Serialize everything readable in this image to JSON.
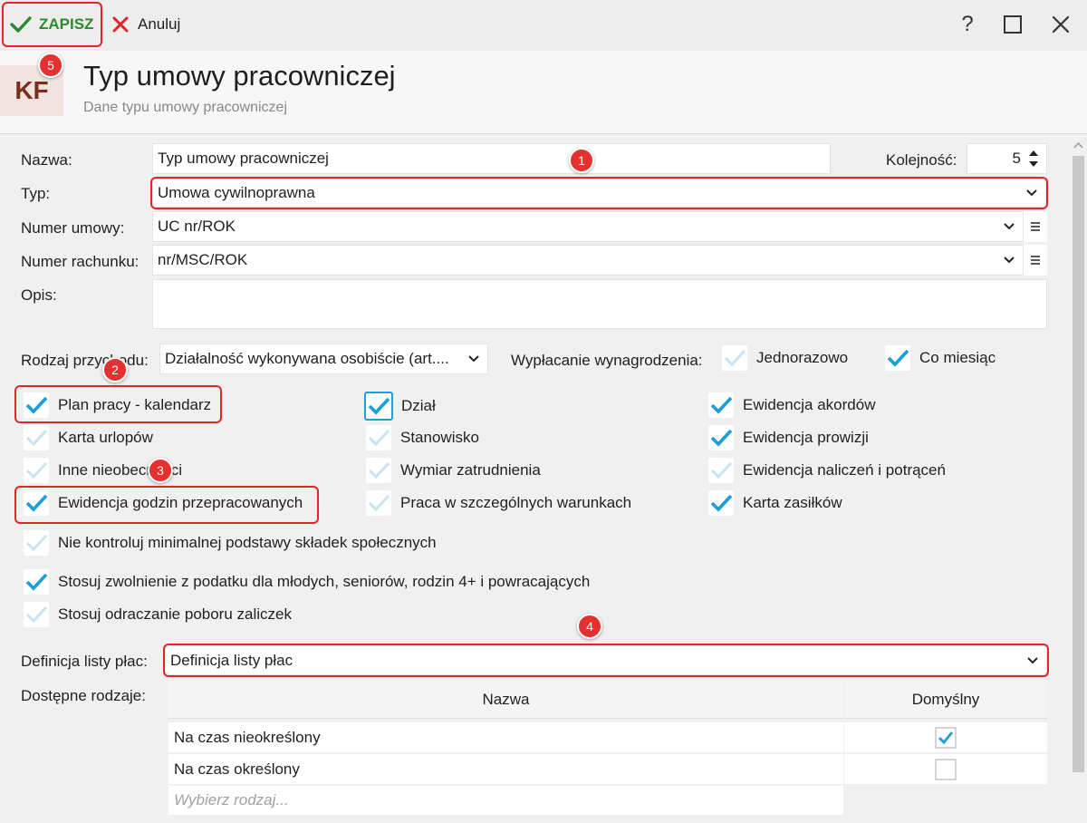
{
  "toolbar": {
    "save_label": "ZAPISZ",
    "cancel_label": "Anuluj",
    "help_glyph": "?",
    "maximize_glyph": "☐",
    "close_glyph": "✕"
  },
  "header": {
    "logo_text": "KF",
    "title": "Typ umowy pracowniczej",
    "subtitle": "Dane typu umowy pracowniczej"
  },
  "form": {
    "nazwa_label": "Nazwa:",
    "nazwa_value": "Typ umowy pracowniczej",
    "kolejnosc_label": "Kolejność:",
    "kolejnosc_value": "5",
    "typ_label": "Typ:",
    "typ_value": "Umowa cywilnoprawna",
    "numer_umowy_label": "Numer umowy:",
    "numer_umowy_value": "UC nr/ROK",
    "numer_rachunku_label": "Numer rachunku:",
    "numer_rachunku_value": "nr/MSC/ROK",
    "opis_label": "Opis:",
    "opis_value": "",
    "rodzaj_label": "Rodzaj przychodu:",
    "rodzaj_value": "Działalność wykonywana osobiście (art....",
    "wyplacanie_label": "Wypłacanie wynagrodzenia:",
    "jednorazowo_label": "Jednorazowo",
    "co_miesiac_label": "Co miesiąc",
    "definicja_label": "Definicja listy płac:",
    "definicja_value": "Definicja listy płac",
    "dostepne_label": "Dostępne rodzaje:"
  },
  "checkboxes": {
    "plan_pracy": {
      "label": "Plan pracy - kalendarz",
      "checked": true
    },
    "karta_urlopow": {
      "label": "Karta urlopów",
      "checked": false
    },
    "inne_nieobecnosci": {
      "label": "Inne nieobecności",
      "checked": false
    },
    "ewidencja_godzin": {
      "label": "Ewidencja godzin przepracowanych",
      "checked": true
    },
    "dzial": {
      "label": "Dział",
      "checked": true
    },
    "stanowisko": {
      "label": "Stanowisko",
      "checked": false
    },
    "wymiar": {
      "label": "Wymiar zatrudnienia",
      "checked": false
    },
    "praca_szczegolna": {
      "label": "Praca w szczególnych warunkach",
      "checked": false
    },
    "ewidencja_akordow": {
      "label": "Ewidencja akordów",
      "checked": true
    },
    "ewidencja_prowizji": {
      "label": "Ewidencja prowizji",
      "checked": true
    },
    "ewidencja_naliczen": {
      "label": "Ewidencja naliczeń i potrąceń",
      "checked": false
    },
    "karta_zasilkow": {
      "label": "Karta zasiłków",
      "checked": true
    },
    "nie_kontroluj": {
      "label": "Nie kontroluj minimalnej podstawy składek społecznych",
      "checked": false
    },
    "stosuj_zwolnienie": {
      "label": "Stosuj zwolnienie z podatku dla młodych, seniorów, rodzin 4+ i powracających",
      "checked": true
    },
    "stosuj_odraczanie": {
      "label": "Stosuj odraczanie poboru zaliczek",
      "checked": false
    }
  },
  "table": {
    "col_nazwa": "Nazwa",
    "col_domyslny": "Domyślny",
    "rows": [
      {
        "nazwa": "Na czas nieokreślony",
        "domyslny": true
      },
      {
        "nazwa": "Na czas określony",
        "domyslny": false
      }
    ],
    "add_placeholder": "Wybierz rodzaj..."
  },
  "badges": [
    "1",
    "2",
    "3",
    "4",
    "5"
  ],
  "colors": {
    "accent_check": "#1a9fd8",
    "save_green": "#2b8a2b",
    "cancel_red": "#e0262b",
    "highlight_red": "#e0262b",
    "badge_red": "#e53030"
  }
}
